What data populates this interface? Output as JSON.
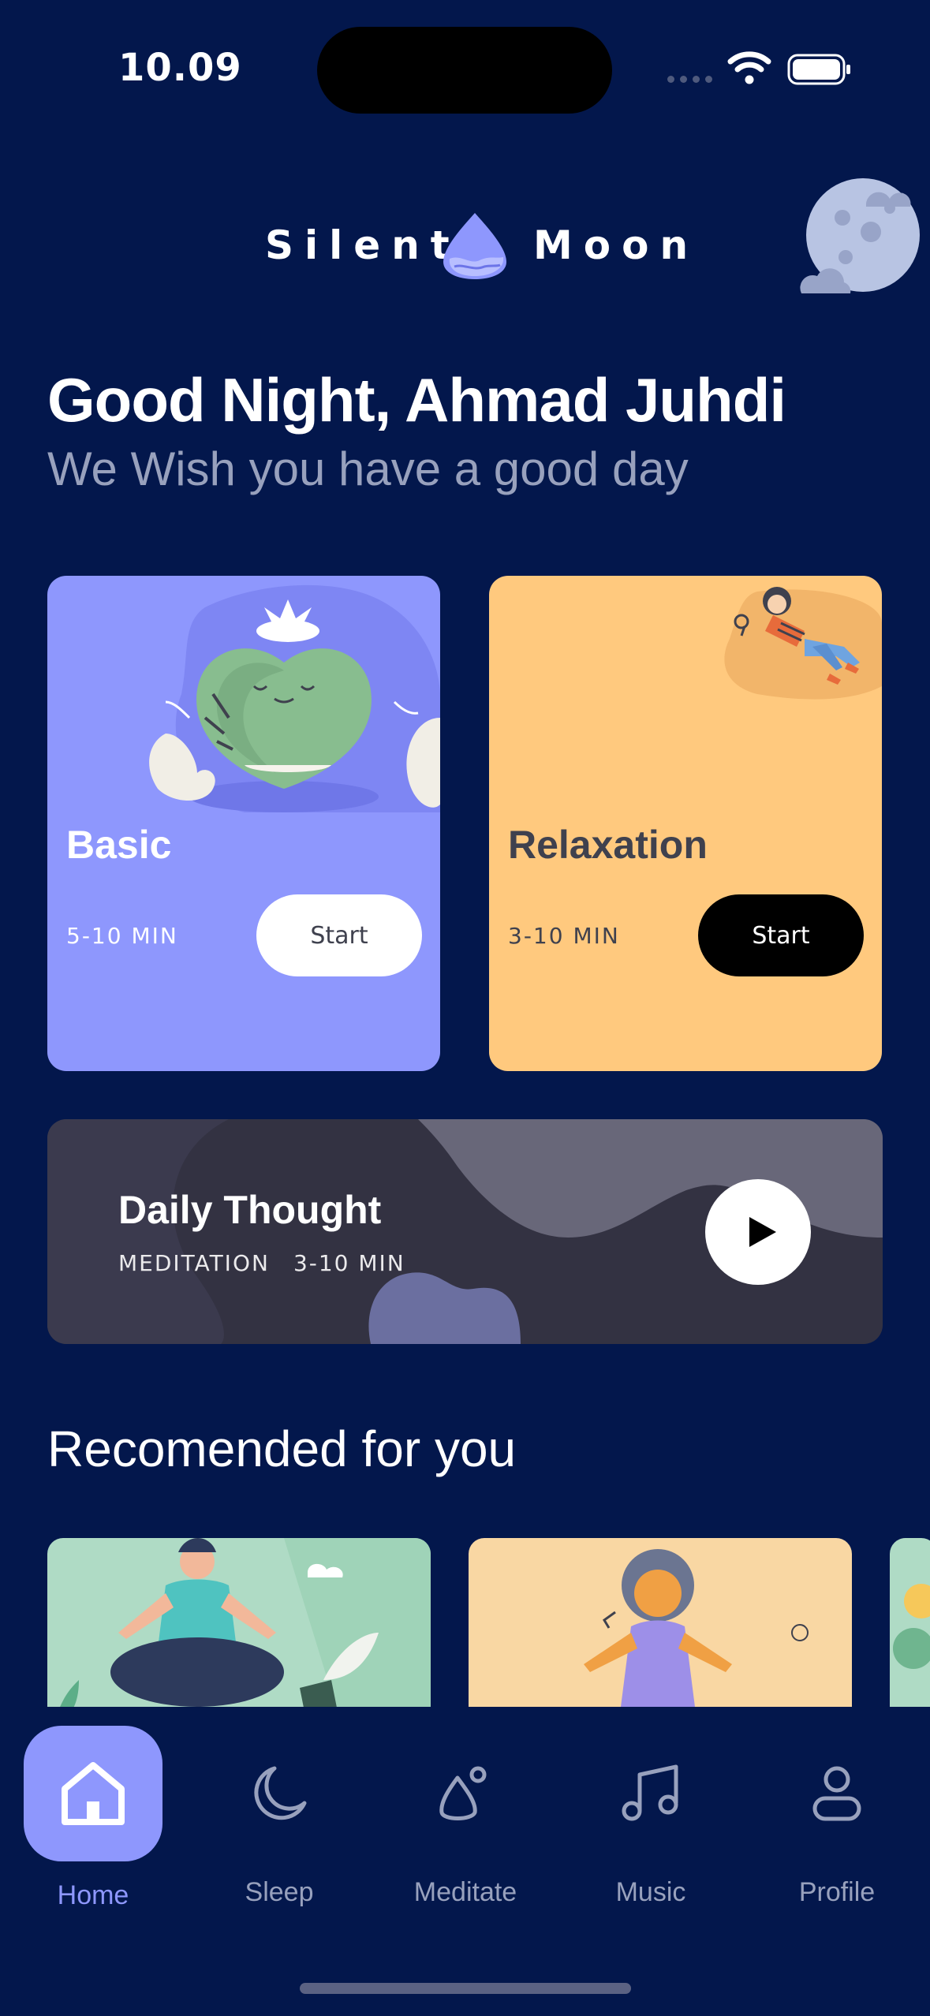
{
  "status_bar": {
    "time": "10.09",
    "icons": [
      "cellular-signal-icon",
      "wifi-icon",
      "battery-icon"
    ]
  },
  "header": {
    "brand_left": "Silent",
    "brand_right": "Moon",
    "logo_icon": "moon-drop-logo",
    "decor_icon": "moon-with-clouds-icon"
  },
  "greeting": {
    "title": "Good Night, Ahmad Juhdi",
    "subtitle": "We Wish you have a good day"
  },
  "cards": [
    {
      "title": "Basic",
      "duration": "5-10 MIN",
      "button": "Start",
      "color": "#8E97FD",
      "illustration": "heart-character-illustration"
    },
    {
      "title": "Relaxation",
      "duration": "3-10 MIN",
      "button": "Start",
      "color": "#FFC97E",
      "illustration": "relaxing-person-illustration"
    }
  ],
  "daily_thought": {
    "title": "Daily Thought",
    "category": "MEDITATION",
    "duration": "3-10 MIN",
    "action_icon": "play-icon"
  },
  "recommended": {
    "title": "Recomended for you",
    "items": [
      {
        "illustration": "meditating-man-illustration",
        "color": "#AFDBC5"
      },
      {
        "illustration": "meditating-woman-illustration",
        "color": "#F9D7A3"
      },
      {
        "illustration": "nature-illustration",
        "color": "#AFDBC5"
      }
    ]
  },
  "tabs": [
    {
      "label": "Home",
      "icon": "home-icon",
      "active": true
    },
    {
      "label": "Sleep",
      "icon": "moon-icon",
      "active": false
    },
    {
      "label": "Meditate",
      "icon": "meditate-icon",
      "active": false
    },
    {
      "label": "Music",
      "icon": "music-note-icon",
      "active": false
    },
    {
      "label": "Profile",
      "icon": "user-icon",
      "active": false
    }
  ],
  "colors": {
    "background": "#03174C",
    "accent": "#8E97FD",
    "relax": "#FFC97E",
    "muted": "#98A1BD"
  }
}
